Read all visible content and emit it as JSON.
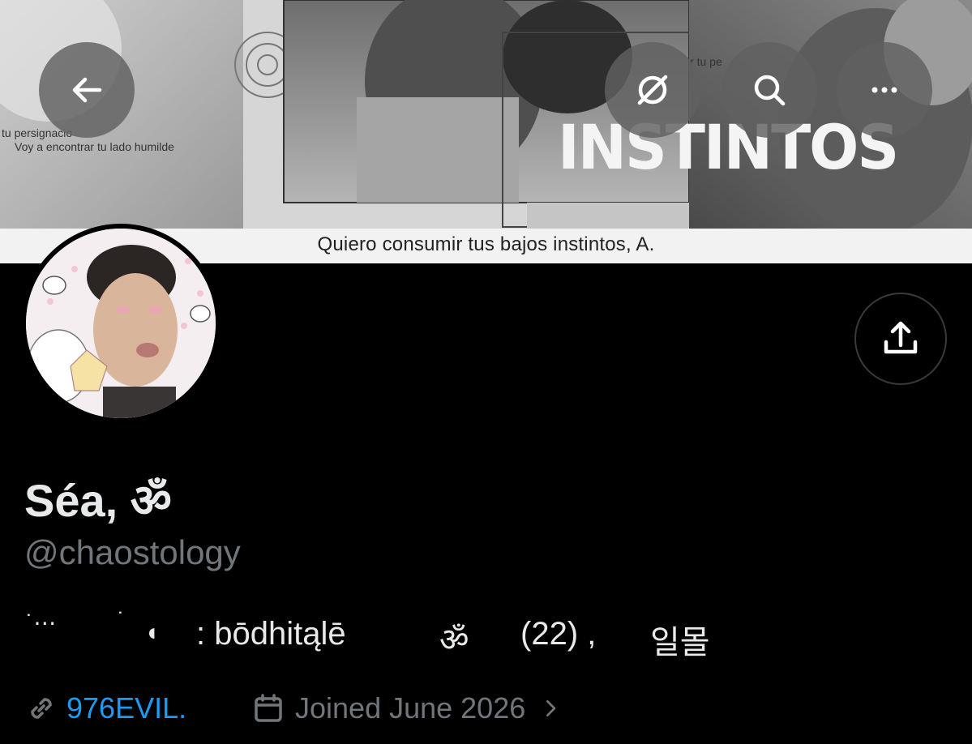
{
  "banner": {
    "caption": "Quiero consumir tus bajos instintos, A.",
    "small_text_1": "tu persignacio",
    "small_text_2": "Voy a encontrar tu lado humilde",
    "small_text_3": "ir tu pe",
    "title_text": "INSTINTOS"
  },
  "toolbar": {
    "back_icon": "arrow-left-icon",
    "translate_icon": "grok-icon",
    "search_icon": "search-icon",
    "more_icon": "ellipsis-icon"
  },
  "share_icon": "share-icon",
  "profile": {
    "display_name": "Séa, ॐ",
    "handle": "@chaostology",
    "bio": {
      "part1": "˙⋯",
      "part2": "˙",
      "part3": "◖",
      "part4": ": bōdhitąlē",
      "part5": "ॐ",
      "part6": "(22) ,",
      "part7": "일몰"
    },
    "link_label": "976EVIL.",
    "joined_label": "Joined June 2026"
  },
  "colors": {
    "background": "#000000",
    "text_primary": "#e7e9ea",
    "text_secondary": "#71767b",
    "link": "#1d9bf0"
  }
}
